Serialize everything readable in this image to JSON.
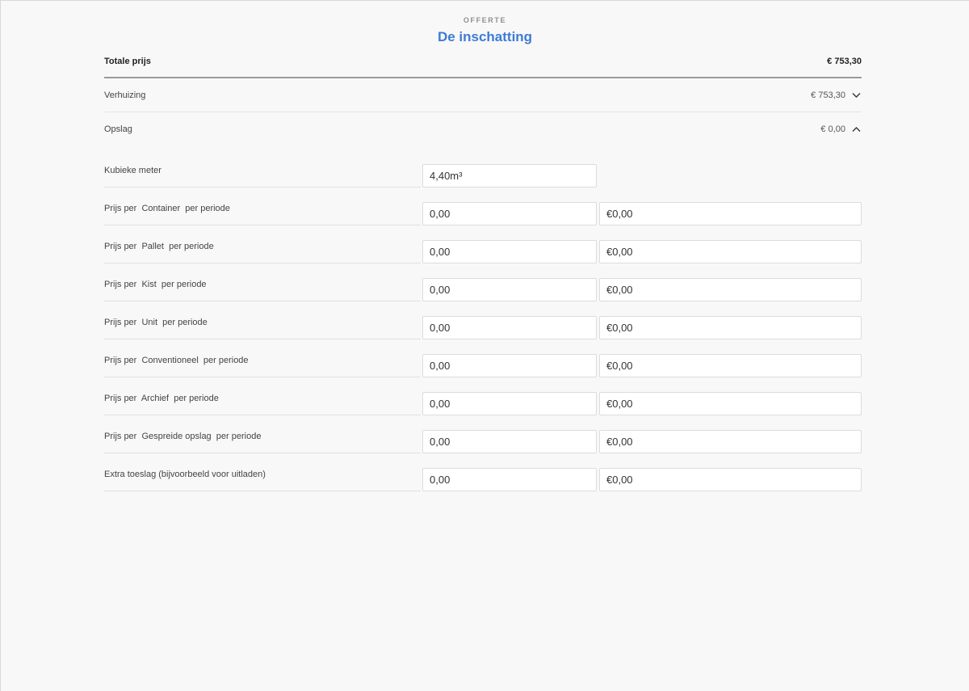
{
  "header": {
    "eyebrow": "OFFERTE",
    "title": "De inschatting"
  },
  "total": {
    "label": "Totale prijs",
    "value": "€ 753,30"
  },
  "sections": [
    {
      "label": "Verhuizing",
      "value": "€ 753,30",
      "expanded": false
    },
    {
      "label": "Opslag",
      "value": "€ 0,00",
      "expanded": true
    }
  ],
  "volume": {
    "label": "Kubieke meter",
    "value": "4,40m³"
  },
  "rows": [
    {
      "label": "Prijs per  Container  per periode",
      "qty": "0,00",
      "price": "€0,00"
    },
    {
      "label": "Prijs per  Pallet  per periode",
      "qty": "0,00",
      "price": "€0,00"
    },
    {
      "label": "Prijs per  Kist  per periode",
      "qty": "0,00",
      "price": "€0,00"
    },
    {
      "label": "Prijs per  Unit  per periode",
      "qty": "0,00",
      "price": "€0,00"
    },
    {
      "label": "Prijs per  Conventioneel  per periode",
      "qty": "0,00",
      "price": "€0,00"
    },
    {
      "label": "Prijs per  Archief  per periode",
      "qty": "0,00",
      "price": "€0,00"
    },
    {
      "label": "Prijs per  Gespreide opslag  per periode",
      "qty": "0,00",
      "price": "€0,00"
    },
    {
      "label": "Extra toeslag (bijvoorbeeld voor uitladen)",
      "qty": "0,00",
      "price": "€0,00"
    }
  ],
  "icons": {
    "collapsed": "chevron-down-icon",
    "expanded": "chevron-up-icon"
  },
  "colors": {
    "accent": "#3d7bd6",
    "background": "#f8f8f8"
  }
}
